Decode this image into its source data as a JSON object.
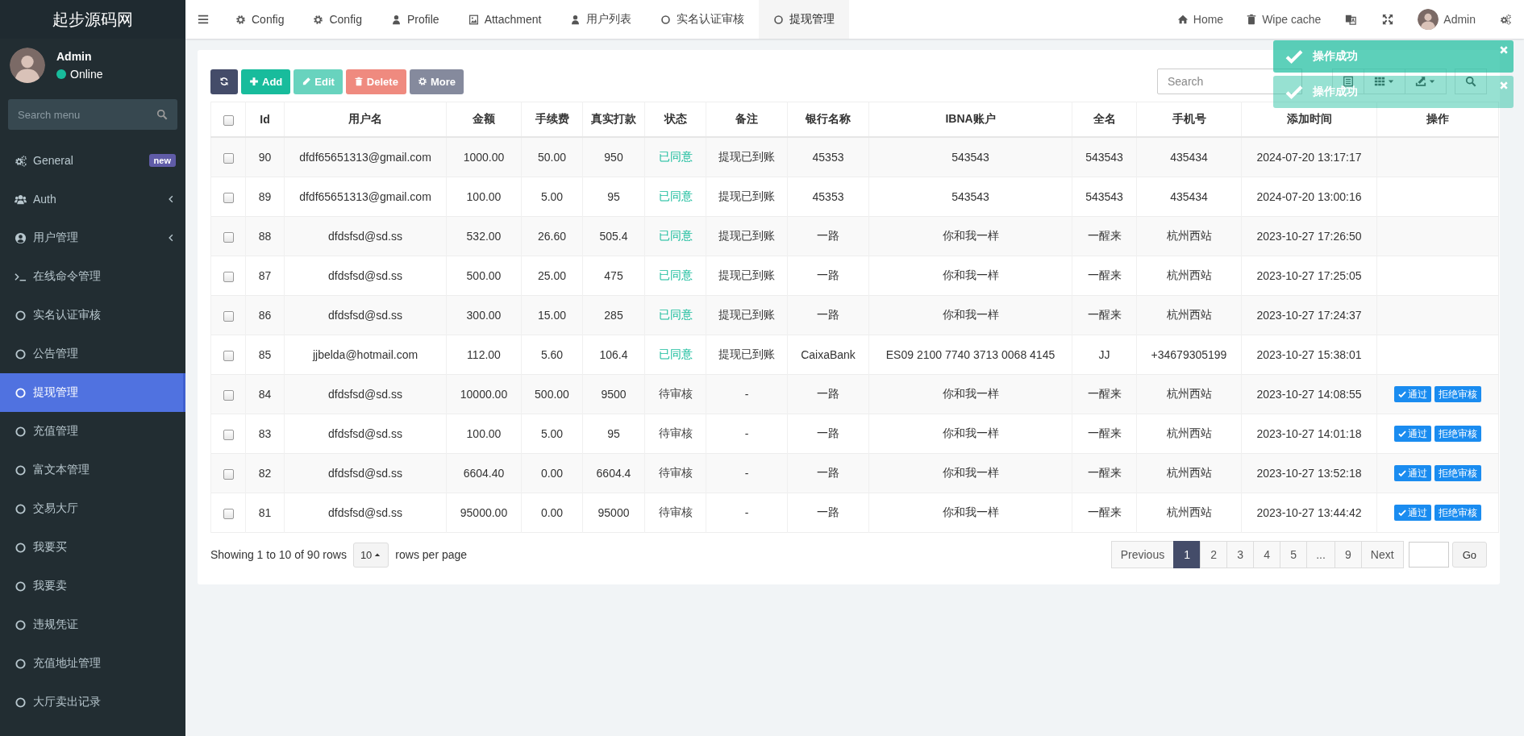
{
  "brand": "起步源码网",
  "user_panel": {
    "name": "Admin",
    "status": "Online",
    "online": true
  },
  "sidebar_search": {
    "placeholder": "Search menu"
  },
  "sidebar": {
    "items": [
      {
        "label": "General",
        "badge": "new",
        "collapsible": false,
        "selected": false
      },
      {
        "label": "Auth",
        "collapsible": true,
        "selected": false
      },
      {
        "label": "用户管理",
        "collapsible": true,
        "selected": false
      },
      {
        "label": "在线命令管理",
        "collapsible": false,
        "selected": false
      },
      {
        "label": "实名认证审核",
        "collapsible": false,
        "selected": false
      },
      {
        "label": "公告管理",
        "collapsible": false,
        "selected": false
      },
      {
        "label": "提现管理",
        "collapsible": false,
        "selected": true
      },
      {
        "label": "充值管理",
        "collapsible": false,
        "selected": false
      },
      {
        "label": "富文本管理",
        "collapsible": false,
        "selected": false
      },
      {
        "label": "交易大厅",
        "collapsible": false,
        "selected": false
      },
      {
        "label": "我要买",
        "collapsible": false,
        "selected": false
      },
      {
        "label": "我要卖",
        "collapsible": false,
        "selected": false
      },
      {
        "label": "违规凭证",
        "collapsible": false,
        "selected": false
      },
      {
        "label": "充值地址管理",
        "collapsible": false,
        "selected": false
      },
      {
        "label": "大厅卖出记录",
        "collapsible": false,
        "selected": false
      }
    ]
  },
  "tabs": [
    {
      "label": "Config",
      "selected": false
    },
    {
      "label": "Config",
      "selected": false
    },
    {
      "label": "Profile",
      "selected": false
    },
    {
      "label": "Attachment",
      "selected": false
    },
    {
      "label": "用户列表",
      "selected": false
    },
    {
      "label": "实名认证审核",
      "selected": false
    },
    {
      "label": "提现管理",
      "selected": true
    }
  ],
  "nav_right": {
    "home": "Home",
    "wipe_cache": "Wipe cache",
    "user": "Admin"
  },
  "toolbar": {
    "buttons": [
      {
        "disabled": false
      },
      {
        "label": "Add",
        "disabled": false
      },
      {
        "label": "Edit",
        "disabled": true
      },
      {
        "label": "Delete",
        "disabled": true
      },
      {
        "label": "More",
        "disabled": true
      }
    ],
    "search": {
      "placeholder": "Search"
    }
  },
  "table": {
    "select_all_checked": false,
    "columns": [
      "Id",
      "用户名",
      "金额",
      "手续费",
      "真实打款",
      "状态",
      "备注",
      "银行名称",
      "IBNA账户",
      "全名",
      "手机号",
      "添加时间",
      "操作"
    ],
    "rows": [
      {
        "checked": false,
        "approved": true,
        "cells": [
          "90",
          "dfdf65651313@gmail.com",
          "1000.00",
          "50.00",
          "950",
          "已同意",
          "提现已到账",
          "45353",
          "543543",
          "543543",
          "435434",
          "2024-07-20 13:17:17"
        ]
      },
      {
        "checked": false,
        "approved": true,
        "cells": [
          "89",
          "dfdf65651313@gmail.com",
          "100.00",
          "5.00",
          "95",
          "已同意",
          "提现已到账",
          "45353",
          "543543",
          "543543",
          "435434",
          "2024-07-20 13:00:16"
        ]
      },
      {
        "checked": false,
        "approved": true,
        "cells": [
          "88",
          "dfdsfsd@sd.ss",
          "532.00",
          "26.60",
          "505.4",
          "已同意",
          "提现已到账",
          "一路",
          "你和我一样",
          "一醒来",
          "杭州西站",
          "2023-10-27 17:26:50"
        ]
      },
      {
        "checked": false,
        "approved": true,
        "cells": [
          "87",
          "dfdsfsd@sd.ss",
          "500.00",
          "25.00",
          "475",
          "已同意",
          "提现已到账",
          "一路",
          "你和我一样",
          "一醒来",
          "杭州西站",
          "2023-10-27 17:25:05"
        ]
      },
      {
        "checked": false,
        "approved": true,
        "cells": [
          "86",
          "dfdsfsd@sd.ss",
          "300.00",
          "15.00",
          "285",
          "已同意",
          "提现已到账",
          "一路",
          "你和我一样",
          "一醒来",
          "杭州西站",
          "2023-10-27 17:24:37"
        ]
      },
      {
        "checked": false,
        "approved": true,
        "cells": [
          "85",
          "jjbelda@hotmail.com",
          "112.00",
          "5.60",
          "106.4",
          "已同意",
          "提现已到账",
          "CaixaBank",
          "ES09 2100 7740 3713 0068 4145",
          "JJ",
          "+34679305199",
          "2023-10-27 15:38:01"
        ]
      },
      {
        "checked": false,
        "approved": false,
        "cells": [
          "84",
          "dfdsfsd@sd.ss",
          "10000.00",
          "500.00",
          "9500",
          "待审核",
          "-",
          "一路",
          "你和我一样",
          "一醒来",
          "杭州西站",
          "2023-10-27 14:08:55"
        ],
        "actions": [
          "通过",
          "拒绝审核"
        ]
      },
      {
        "checked": false,
        "approved": false,
        "cells": [
          "83",
          "dfdsfsd@sd.ss",
          "100.00",
          "5.00",
          "95",
          "待审核",
          "-",
          "一路",
          "你和我一样",
          "一醒来",
          "杭州西站",
          "2023-10-27 14:01:18"
        ],
        "actions": [
          "通过",
          "拒绝审核"
        ]
      },
      {
        "checked": false,
        "approved": false,
        "cells": [
          "82",
          "dfdsfsd@sd.ss",
          "6604.40",
          "0.00",
          "6604.4",
          "待审核",
          "-",
          "一路",
          "你和我一样",
          "一醒来",
          "杭州西站",
          "2023-10-27 13:52:18"
        ],
        "actions": [
          "通过",
          "拒绝审核"
        ]
      },
      {
        "checked": false,
        "approved": false,
        "cells": [
          "81",
          "dfdsfsd@sd.ss",
          "95000.00",
          "0.00",
          "95000",
          "待审核",
          "-",
          "一路",
          "你和我一样",
          "一醒来",
          "杭州西站",
          "2023-10-27 13:44:42"
        ],
        "actions": [
          "通过",
          "拒绝审核"
        ]
      }
    ]
  },
  "pagination": {
    "summary": "Showing 1 to 10 of 90 rows",
    "page_size": "10",
    "suffix": "rows per page",
    "pages": [
      {
        "label": "Previous",
        "selected": false
      },
      {
        "label": "1",
        "selected": true
      },
      {
        "label": "2",
        "selected": false
      },
      {
        "label": "3",
        "selected": false
      },
      {
        "label": "4",
        "selected": false
      },
      {
        "label": "5",
        "selected": false
      },
      {
        "label": "...",
        "selected": false
      },
      {
        "label": "9",
        "selected": false
      },
      {
        "label": "Next",
        "selected": false
      }
    ],
    "go": "Go"
  },
  "toasts": [
    {
      "message": "操作成功",
      "faded": false
    },
    {
      "message": "操作成功",
      "faded": true
    }
  ]
}
